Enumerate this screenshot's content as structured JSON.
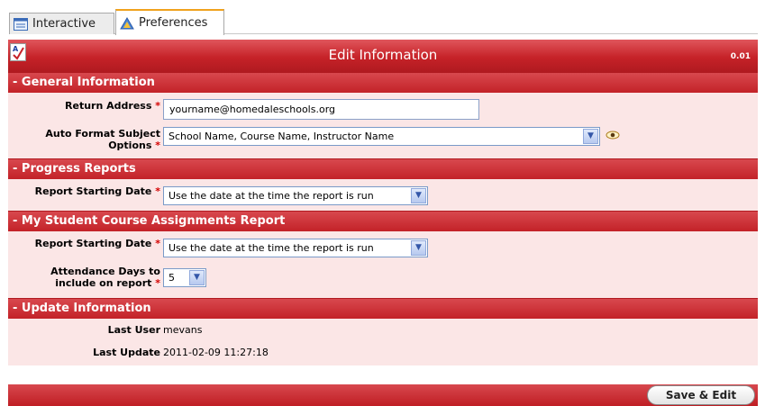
{
  "tabs": [
    {
      "label": "Interactive",
      "icon": "list-window-icon"
    },
    {
      "label": "Preferences",
      "icon": "preferences-icon"
    }
  ],
  "titlebar": {
    "title": "Edit Information",
    "version": "0.01",
    "icon": "spellcheck-icon"
  },
  "sections": {
    "general": {
      "header": "- General Information",
      "return_address_label": "Return Address",
      "return_address_value": "yourname@homedaleschools.org",
      "subject_label_line1": "Auto Format Subject",
      "subject_label_line2": "Options",
      "subject_value": "School Name, Course Name, Instructor Name"
    },
    "progress": {
      "header": "- Progress Reports",
      "start_label": "Report Starting Date",
      "start_value": "Use the date at the time the report is run"
    },
    "assignments": {
      "header": "- My Student Course Assignments Report",
      "start_label": "Report Starting Date",
      "start_value": "Use the date at the time the report is run",
      "attendance_label_line1": "Attendance Days to",
      "attendance_label_line2": "include on report",
      "attendance_value": "5"
    },
    "update": {
      "header": "- Update Information",
      "last_user_label": "Last User",
      "last_user_value": "mevans",
      "last_update_label": "Last Update",
      "last_update_value": "2011-02-09 11:27:18"
    }
  },
  "required_marker": "*",
  "footer": {
    "save_label": "Save & Edit"
  },
  "colors": {
    "header_red": "#c62228",
    "form_bg": "#fbe6e6",
    "tab_accent": "#f0a21d"
  }
}
